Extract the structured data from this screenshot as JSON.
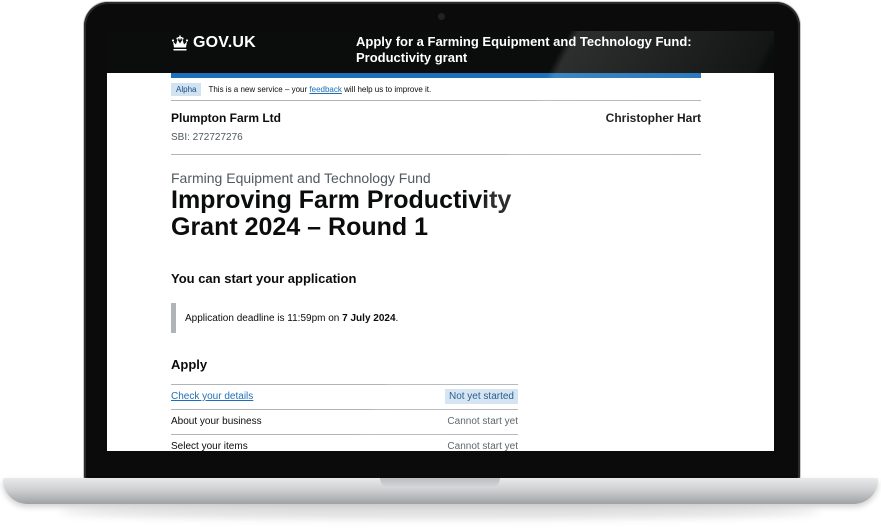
{
  "header": {
    "logo_text": "GOV.UK",
    "service_name": "Apply for a Farming Equipment and Technology Fund: Productivity grant"
  },
  "phase_banner": {
    "tag": "Alpha",
    "text_before": "This is a new service – your",
    "link": "feedback",
    "text_after": "will help us to improve it."
  },
  "organisation": {
    "name": "Plumpton Farm Ltd",
    "sbi": "SBI: 272727276",
    "user": "Christopher Hart"
  },
  "main": {
    "caption": "Farming Equipment and Technology Fund",
    "title": "Improving Farm Productivity Grant 2024 – Round 1",
    "start_heading": "You can start your application",
    "deadline_text": "Application deadline is 11:59pm on",
    "deadline_date": "7 July 2024",
    "deadline_end": ".",
    "apply_heading": "Apply"
  },
  "tasks": [
    {
      "name": "Check your details",
      "status": "Not yet started"
    },
    {
      "name": "About your business",
      "status": "Cannot start yet"
    },
    {
      "name": "Select your items",
      "status": "Cannot start yet"
    }
  ],
  "colors": {
    "header_bg": "#0b0c0c",
    "brand_blue": "#1d70b8",
    "tag_bg": "#d2e2f1",
    "tag_text": "#144e81"
  },
  "icons": {
    "logo": "crown-icon"
  }
}
